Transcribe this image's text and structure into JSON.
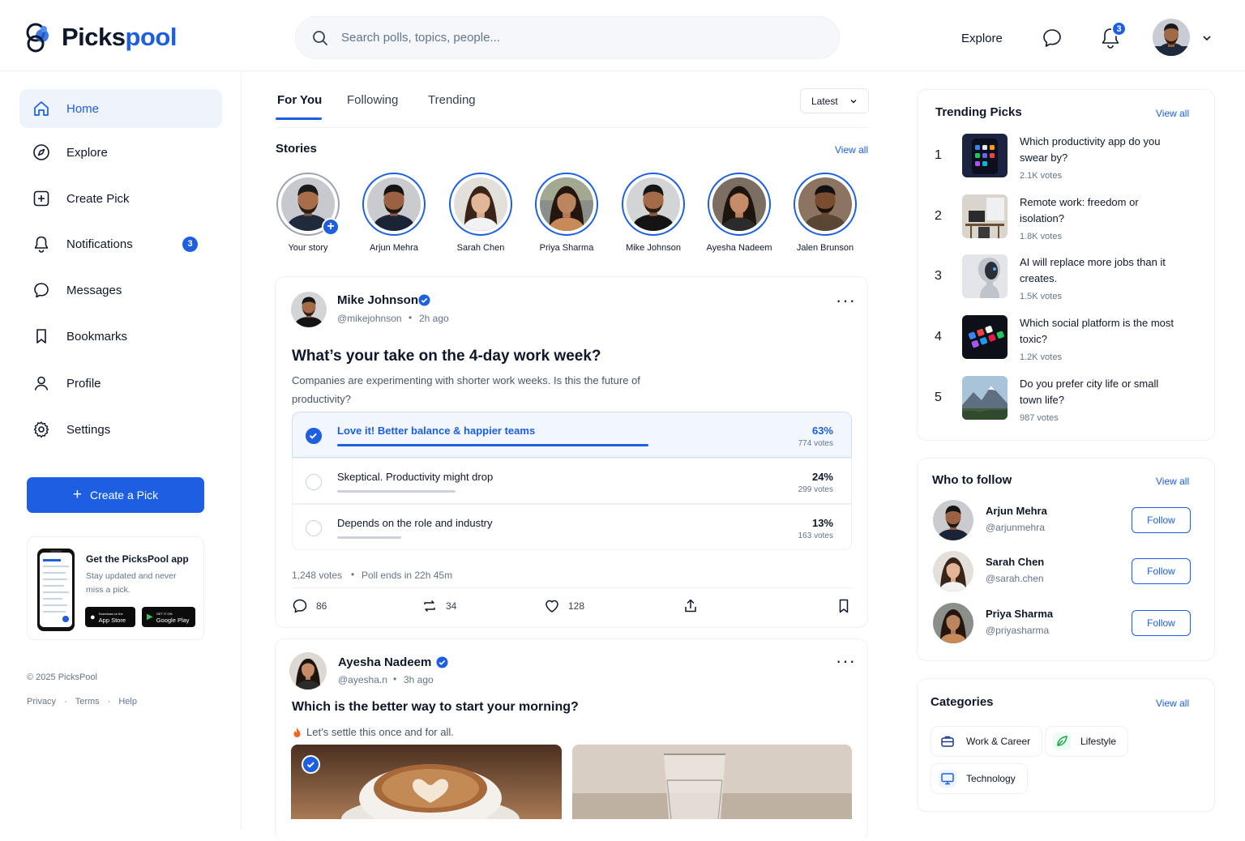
{
  "brand": {
    "name_part1": "Picks",
    "name_part2": "pool",
    "accent": "#1d5fe0"
  },
  "search": {
    "placeholder": "Search polls, topics, people..."
  },
  "topnav": {
    "explore": "Explore",
    "notification_count": "3"
  },
  "sidebar": {
    "items": [
      {
        "label": "Home",
        "icon": "home-icon"
      },
      {
        "label": "Explore",
        "icon": "compass-icon"
      },
      {
        "label": "Create Pick",
        "icon": "plus-square-icon"
      },
      {
        "label": "Notifications",
        "icon": "bell-icon",
        "badge": "3"
      },
      {
        "label": "Messages",
        "icon": "chat-icon"
      },
      {
        "label": "Bookmarks",
        "icon": "bookmark-icon"
      },
      {
        "label": "Profile",
        "icon": "user-icon"
      },
      {
        "label": "Settings",
        "icon": "gear-icon"
      }
    ],
    "create_button": "Create a Pick",
    "app_promo": {
      "title": "Get the PicksPool app",
      "subtitle": "Stay updated and never miss a pick.",
      "app_store_small": "Download on the",
      "app_store": "App Store",
      "google_small": "GET IT ON",
      "google": "Google Play"
    },
    "copyright": "© 2025 PicksPool",
    "links": [
      "Privacy",
      "Terms",
      "Help"
    ]
  },
  "feed": {
    "tabs": [
      "For You",
      "Following",
      "Trending"
    ],
    "sort": "Latest",
    "stories_title": "Stories",
    "view_all": "View all",
    "stories": [
      "Your story",
      "Arjun Mehra",
      "Sarah Chen",
      "Priya Sharma",
      "Mike Johnson",
      "Ayesha Nadeem",
      "Jalen Brunson"
    ],
    "post1": {
      "author": "Mike Johnson",
      "handle": "@mikejohnson",
      "time": "2h ago",
      "title": "What’s your take on the 4-day work week?",
      "desc": "Companies are experimenting with shorter work weeks. Is this the future of productivity?",
      "options": [
        {
          "label": "Love it! Better balance & happier teams",
          "pct": "63%",
          "votes": "774 votes",
          "share": 0.63
        },
        {
          "label": "Skeptical. Productivity might drop",
          "pct": "24%",
          "votes": "299 votes",
          "share": 0.24
        },
        {
          "label": "Depends on the role and industry",
          "pct": "13%",
          "votes": "163 votes",
          "share": 0.13
        }
      ],
      "total_votes": "1,248 votes",
      "ends": "Poll ends in 22h 45m",
      "comments": "86",
      "reposts": "34",
      "likes": "128"
    },
    "post2": {
      "author": "Ayesha Nadeem",
      "handle": "@ayesha.n",
      "time": "3h ago",
      "title": "Which is the better way to start your morning?",
      "desc": "Let’s settle this once and for all."
    }
  },
  "trending": {
    "title": "Trending Picks",
    "view_all": "View all",
    "items": [
      {
        "num": "1",
        "q": "Which productivity app do you swear by?",
        "votes": "2.1K votes"
      },
      {
        "num": "2",
        "q": "Remote work: freedom or isolation?",
        "votes": "1.8K votes"
      },
      {
        "num": "3",
        "q": "AI will replace more jobs than it creates.",
        "votes": "1.5K votes"
      },
      {
        "num": "4",
        "q": "Which social platform is the most toxic?",
        "votes": "1.2K votes"
      },
      {
        "num": "5",
        "q": "Do you prefer city life or small town life?",
        "votes": "987 votes"
      }
    ]
  },
  "who_to_follow": {
    "title": "Who to follow",
    "view_all": "View all",
    "follow_label": "Follow",
    "people": [
      {
        "name": "Arjun Mehra",
        "handle": "@arjunmehra"
      },
      {
        "name": "Sarah Chen",
        "handle": "@sarah.chen"
      },
      {
        "name": "Priya Sharma",
        "handle": "@priyasharma"
      }
    ]
  },
  "categories": {
    "title": "Categories",
    "view_all": "View all",
    "items": [
      "Work & Career",
      "Lifestyle",
      "Technology"
    ]
  }
}
